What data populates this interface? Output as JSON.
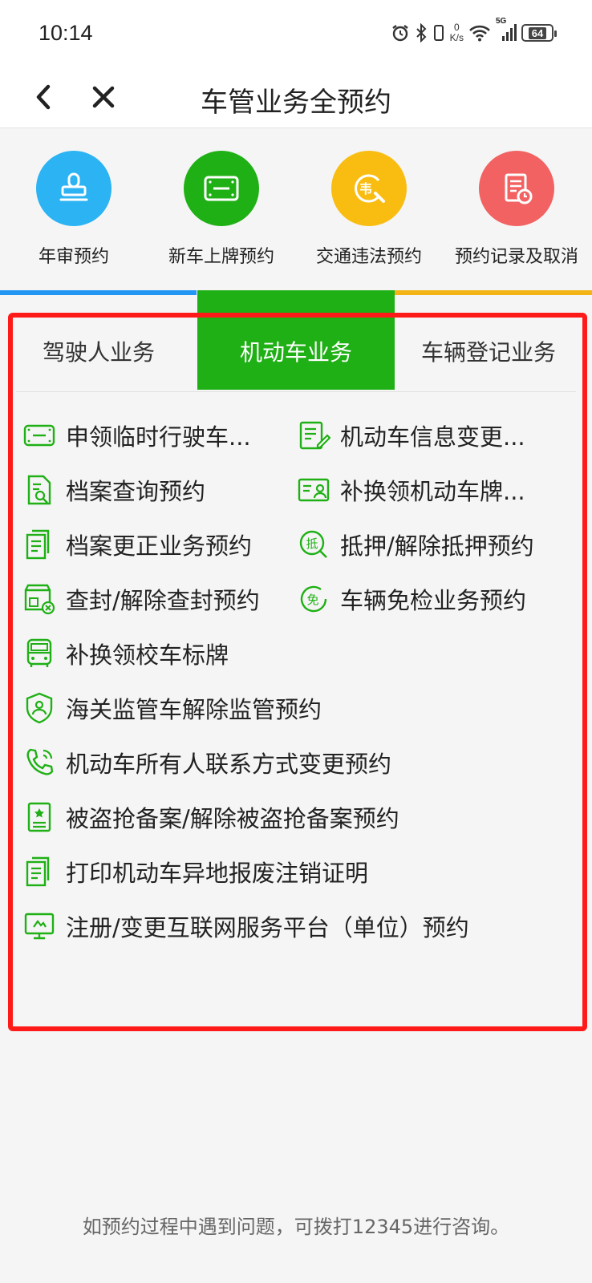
{
  "status": {
    "time": "10:14",
    "speed_value": "0",
    "speed_unit": "K/s",
    "network": "5G",
    "battery": "64"
  },
  "title": "车管业务全预约",
  "quick_actions": [
    {
      "label": "年审预约",
      "color": "#2bb3f3",
      "icon": "stamp-icon"
    },
    {
      "label": "新车上牌预约",
      "color": "#1fb015",
      "icon": "license-plate-icon"
    },
    {
      "label": "交通违法预约",
      "color": "#f9bd12",
      "icon": "violation-search-icon"
    },
    {
      "label": "预约记录及取消",
      "color": "#f26262",
      "icon": "record-clock-icon"
    }
  ],
  "tabs": [
    {
      "label": "驾驶人业务"
    },
    {
      "label": "机动车业务"
    },
    {
      "label": "车辆登记业务"
    }
  ],
  "services": [
    {
      "label": "申领临时行驶车...",
      "icon": "plate-icon"
    },
    {
      "label": "机动车信息变更...",
      "icon": "edit-document-icon"
    },
    {
      "label": "档案查询预约",
      "icon": "document-search-icon"
    },
    {
      "label": "补换领机动车牌...",
      "icon": "id-card-icon"
    },
    {
      "label": "档案更正业务预约",
      "icon": "documents-icon"
    },
    {
      "label": "抵押/解除抵押预约",
      "icon": "mortgage-icon"
    },
    {
      "label": "查封/解除查封预约",
      "icon": "seal-shop-icon"
    },
    {
      "label": "车辆免检业务预约",
      "icon": "exempt-icon"
    },
    {
      "label": "补换领校车标牌",
      "icon": "school-bus-icon"
    },
    {
      "label": "海关监管车解除监管预约",
      "icon": "shield-user-icon"
    },
    {
      "label": "机动车所有人联系方式变更预约",
      "icon": "phone-icon"
    },
    {
      "label": "被盗抢备案/解除被盗抢备案预约",
      "icon": "certificate-icon"
    },
    {
      "label": "打印机动车异地报废注销证明",
      "icon": "documents-icon"
    },
    {
      "label": "注册/变更互联网服务平台（单位）预约",
      "icon": "monitor-icon"
    }
  ],
  "footer": "如预约过程中遇到问题，可拨打12345进行咨询。",
  "colors": {
    "green": "#1fb015",
    "red_highlight": "#ff1a1a",
    "blue": "#2196f3",
    "yellow": "#f2b515"
  }
}
